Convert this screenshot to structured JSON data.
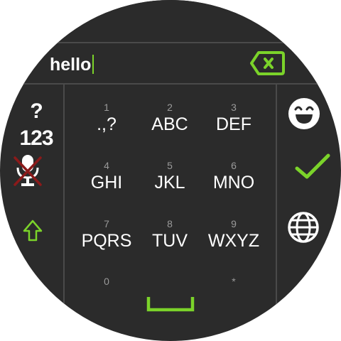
{
  "input": {
    "value": "hello"
  },
  "left_column": {
    "symbols_label": "?123",
    "mic_icon": "mic-off-icon",
    "shift_icon": "shift-icon"
  },
  "right_column": {
    "emoji_icon": "emoji-icon",
    "enter_icon": "checkmark-icon",
    "language_icon": "globe-icon"
  },
  "keys": [
    {
      "number": "1",
      "letters": ".,?"
    },
    {
      "number": "2",
      "letters": "ABC"
    },
    {
      "number": "3",
      "letters": "DEF"
    },
    {
      "number": "4",
      "letters": "GHI"
    },
    {
      "number": "5",
      "letters": "JKL"
    },
    {
      "number": "6",
      "letters": "MNO"
    },
    {
      "number": "7",
      "letters": "PQRS"
    },
    {
      "number": "8",
      "letters": "TUV"
    },
    {
      "number": "9",
      "letters": "WXYZ"
    },
    {
      "number": "0",
      "letters": ""
    },
    {
      "number": "*",
      "letters": ""
    }
  ],
  "colors": {
    "background": "#2b2b2b",
    "accent": "#7bd32a",
    "mic_disabled": "#8b1a1a",
    "divider": "#4a4a4a",
    "text": "#ffffff",
    "number_text": "#9a9a9a"
  }
}
